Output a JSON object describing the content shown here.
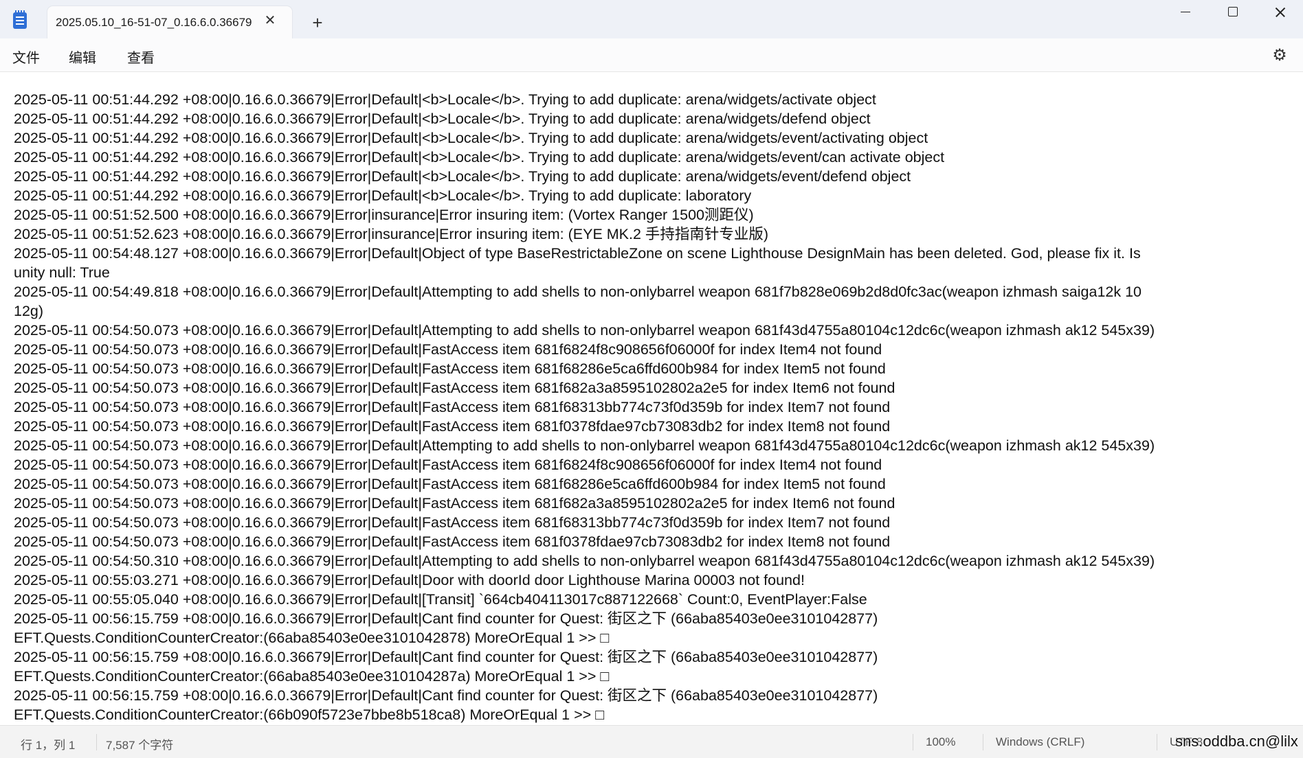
{
  "titlebar": {
    "tab_title": "2025.05.10_16-51-07_0.16.6.0.36679",
    "close_tab": "✕",
    "new_tab": "+"
  },
  "menu": {
    "file": "文件",
    "edit": "编辑",
    "view": "查看"
  },
  "editor": {
    "lines": [
      "2025-05-11 00:51:44.292 +08:00|0.16.6.0.36679|Error|Default|<b>Locale</b>. Trying to add duplicate: arena/widgets/activate object",
      "2025-05-11 00:51:44.292 +08:00|0.16.6.0.36679|Error|Default|<b>Locale</b>. Trying to add duplicate: arena/widgets/defend object",
      "2025-05-11 00:51:44.292 +08:00|0.16.6.0.36679|Error|Default|<b>Locale</b>. Trying to add duplicate: arena/widgets/event/activating object",
      "2025-05-11 00:51:44.292 +08:00|0.16.6.0.36679|Error|Default|<b>Locale</b>. Trying to add duplicate: arena/widgets/event/can activate object",
      "2025-05-11 00:51:44.292 +08:00|0.16.6.0.36679|Error|Default|<b>Locale</b>. Trying to add duplicate: arena/widgets/event/defend object",
      "2025-05-11 00:51:44.292 +08:00|0.16.6.0.36679|Error|Default|<b>Locale</b>. Trying to add duplicate: laboratory",
      "2025-05-11 00:51:52.500 +08:00|0.16.6.0.36679|Error|insurance|Error insuring item: (Vortex Ranger 1500测距仪)",
      "2025-05-11 00:51:52.623 +08:00|0.16.6.0.36679|Error|insurance|Error insuring item: (EYE MK.2 手持指南针专业版)",
      "2025-05-11 00:54:48.127 +08:00|0.16.6.0.36679|Error|Default|Object of type BaseRestrictableZone on scene Lighthouse DesignMain has been deleted. God, please fix it. Is",
      "unity null: True",
      "2025-05-11 00:54:49.818 +08:00|0.16.6.0.36679|Error|Default|Attempting to add shells to non-onlybarrel weapon 681f7b828e069b2d8d0fc3ac(weapon izhmash saiga12k 10",
      "12g)",
      "2025-05-11 00:54:50.073 +08:00|0.16.6.0.36679|Error|Default|Attempting to add shells to non-onlybarrel weapon 681f43d4755a80104c12dc6c(weapon izhmash ak12 545x39)",
      "2025-05-11 00:54:50.073 +08:00|0.16.6.0.36679|Error|Default|FastAccess item 681f6824f8c908656f06000f for index Item4 not found",
      "2025-05-11 00:54:50.073 +08:00|0.16.6.0.36679|Error|Default|FastAccess item 681f68286e5ca6ffd600b984 for index Item5 not found",
      "2025-05-11 00:54:50.073 +08:00|0.16.6.0.36679|Error|Default|FastAccess item 681f682a3a8595102802a2e5 for index Item6 not found",
      "2025-05-11 00:54:50.073 +08:00|0.16.6.0.36679|Error|Default|FastAccess item 681f68313bb774c73f0d359b for index Item7 not found",
      "2025-05-11 00:54:50.073 +08:00|0.16.6.0.36679|Error|Default|FastAccess item 681f0378fdae97cb73083db2 for index Item8 not found",
      "2025-05-11 00:54:50.073 +08:00|0.16.6.0.36679|Error|Default|Attempting to add shells to non-onlybarrel weapon 681f43d4755a80104c12dc6c(weapon izhmash ak12 545x39)",
      "2025-05-11 00:54:50.073 +08:00|0.16.6.0.36679|Error|Default|FastAccess item 681f6824f8c908656f06000f for index Item4 not found",
      "2025-05-11 00:54:50.073 +08:00|0.16.6.0.36679|Error|Default|FastAccess item 681f68286e5ca6ffd600b984 for index Item5 not found",
      "2025-05-11 00:54:50.073 +08:00|0.16.6.0.36679|Error|Default|FastAccess item 681f682a3a8595102802a2e5 for index Item6 not found",
      "2025-05-11 00:54:50.073 +08:00|0.16.6.0.36679|Error|Default|FastAccess item 681f68313bb774c73f0d359b for index Item7 not found",
      "2025-05-11 00:54:50.073 +08:00|0.16.6.0.36679|Error|Default|FastAccess item 681f0378fdae97cb73083db2 for index Item8 not found",
      "2025-05-11 00:54:50.310 +08:00|0.16.6.0.36679|Error|Default|Attempting to add shells to non-onlybarrel weapon 681f43d4755a80104c12dc6c(weapon izhmash ak12 545x39)",
      "2025-05-11 00:55:03.271 +08:00|0.16.6.0.36679|Error|Default|Door with doorId door Lighthouse Marina 00003 not found!",
      "2025-05-11 00:55:05.040 +08:00|0.16.6.0.36679|Error|Default|[Transit] `664cb404113017c887122668` Count:0, EventPlayer:False",
      "2025-05-11 00:56:15.759 +08:00|0.16.6.0.36679|Error|Default|Cant find counter for Quest: 街区之下 (66aba85403e0ee3101042877)",
      "EFT.Quests.ConditionCounterCreator:(66aba85403e0ee3101042878) MoreOrEqual 1 >> □",
      "2025-05-11 00:56:15.759 +08:00|0.16.6.0.36679|Error|Default|Cant find counter for Quest: 街区之下 (66aba85403e0ee3101042877)",
      "EFT.Quests.ConditionCounterCreator:(66aba85403e0ee310104287a) MoreOrEqual 1 >> □",
      "2025-05-11 00:56:15.759 +08:00|0.16.6.0.36679|Error|Default|Cant find counter for Quest: 街区之下 (66aba85403e0ee3101042877)",
      "EFT.Quests.ConditionCounterCreator:(66b090f5723e7bbe8b518ca8) MoreOrEqual 1 >> □"
    ]
  },
  "statusbar": {
    "position": "行 1，列 1",
    "chars": "7,587 个字符",
    "zoom": "100%",
    "line_ending": "Windows (CRLF)",
    "encoding": "UTF-8"
  },
  "watermark": "sns.oddba.cn@lilx"
}
